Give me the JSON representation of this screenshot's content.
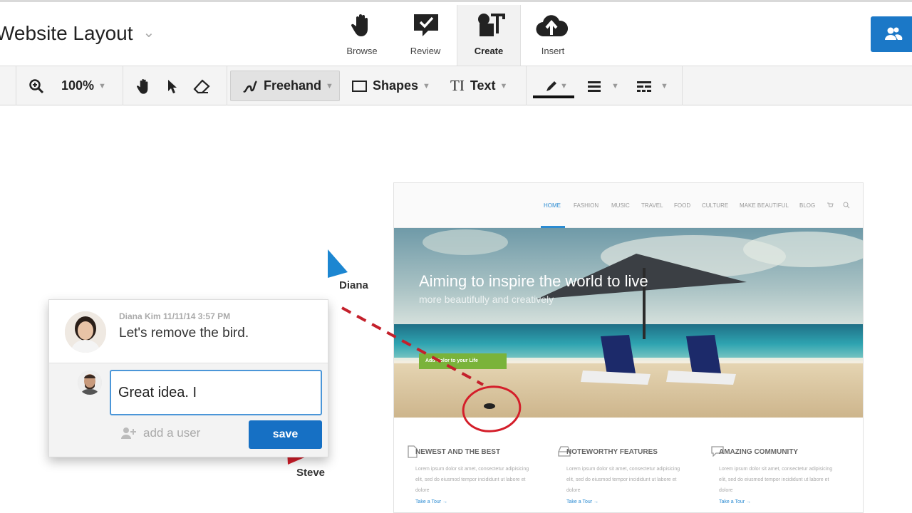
{
  "header": {
    "doc_title": "Website Layout",
    "modes": [
      {
        "label": "Browse",
        "icon": "hand-icon"
      },
      {
        "label": "Review",
        "icon": "review-icon"
      },
      {
        "label": "Create",
        "icon": "create-icon"
      },
      {
        "label": "Insert",
        "icon": "cloud-upload-icon"
      }
    ],
    "active_mode": "Create",
    "share_icon": "users-icon",
    "accent": "#1b78c7"
  },
  "toolbar": {
    "zoom": "100%",
    "freehand_label": "Freehand",
    "shapes_label": "Shapes",
    "text_label": "Text",
    "text_icon": "TI"
  },
  "comment": {
    "author_meta": "Diana Kim 11/11/14 3:57 PM",
    "text": "Let's remove the bird.",
    "reply_value": "Great idea. I",
    "add_user_label": "add a user",
    "save_label": "save"
  },
  "cursors": {
    "diana": {
      "label": "Diana",
      "color": "#1c86d1"
    },
    "steve": {
      "label": "Steve",
      "color": "#d41e2a"
    }
  },
  "preview": {
    "nav": [
      "HOME",
      "FASHION",
      "MUSIC",
      "TRAVEL",
      "FOOD",
      "CULTURE",
      "MAKE BEAUTIFUL",
      "BLOG"
    ],
    "hero_title": "Aiming to inspire the world to live",
    "hero_subtitle": "more beautifully and creatively",
    "hero_button": "Add Color to your Life",
    "features": [
      {
        "heading": "NEWEST AND THE BEST",
        "body": "Lorem ipsum dolor sit amet, consectetur adipisicing elit, sed do eiusmod tempor incididunt ut labore et dolore",
        "link": "Take a Tour →"
      },
      {
        "heading": "NOTEWORTHY FEATURES",
        "body": "Lorem ipsum dolor sit amet, consectetur adipisicing elit, sed do eiusmod tempor incididunt ut labore et dolore",
        "link": "Take a Tour →"
      },
      {
        "heading": "AMAZING COMMUNITY",
        "body": "Lorem ipsum dolor sit amet, consectetur adipisicing elit, sed do eiusmod tempor incididunt ut labore et dolore",
        "link": "Take a Tour →"
      }
    ]
  }
}
